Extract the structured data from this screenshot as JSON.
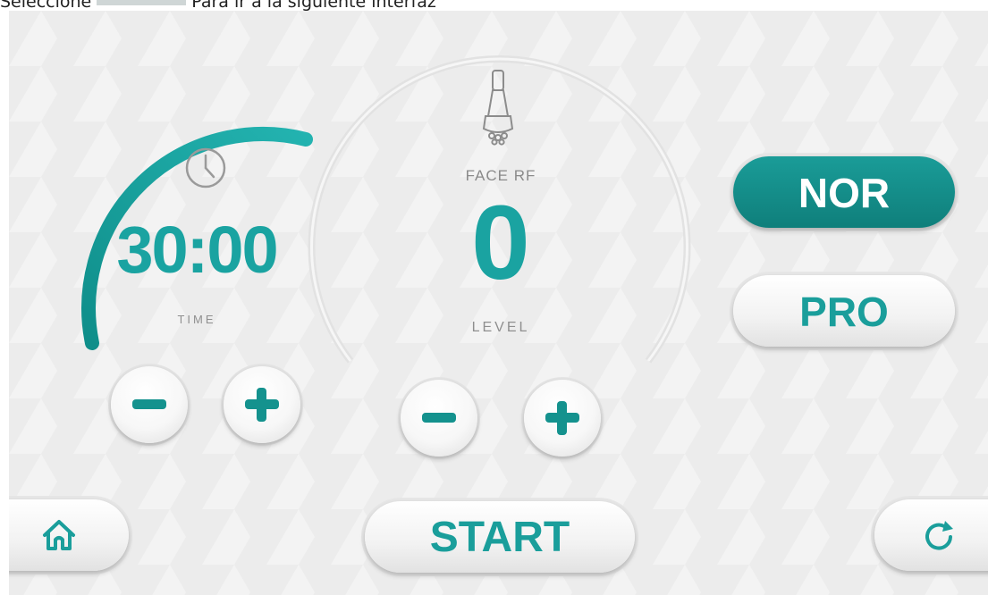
{
  "caption": {
    "prefix": "Seleccione",
    "suffix": "Para ir a la siguiente interfaz"
  },
  "timer": {
    "value": "30:00",
    "label": "TIME",
    "progress_fraction": 0.55
  },
  "handpiece": {
    "name": "FACE RF",
    "level": "0",
    "level_label": "LEVEL"
  },
  "modes": {
    "nor_label": "NOR",
    "pro_label": "PRO",
    "active": "NOR"
  },
  "start_label": "START",
  "icons": {
    "clock": "clock-icon",
    "handpiece": "rf-handpiece-icon",
    "home": "home-icon",
    "reset": "refresh-icon",
    "minus": "minus-icon",
    "plus": "plus-icon"
  },
  "colors": {
    "accent": "#1aa3a1",
    "accent_dark": "#0f7f7b",
    "background": "#ececec",
    "label_gray": "#8f8f8f"
  }
}
